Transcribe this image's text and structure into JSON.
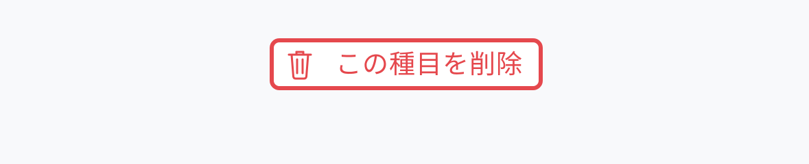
{
  "delete_button": {
    "label": "この種目を削除",
    "icon": "trash-icon"
  },
  "colors": {
    "accent": "#e5484d",
    "background": "#f8f9fb",
    "button_background": "#ffffff"
  }
}
